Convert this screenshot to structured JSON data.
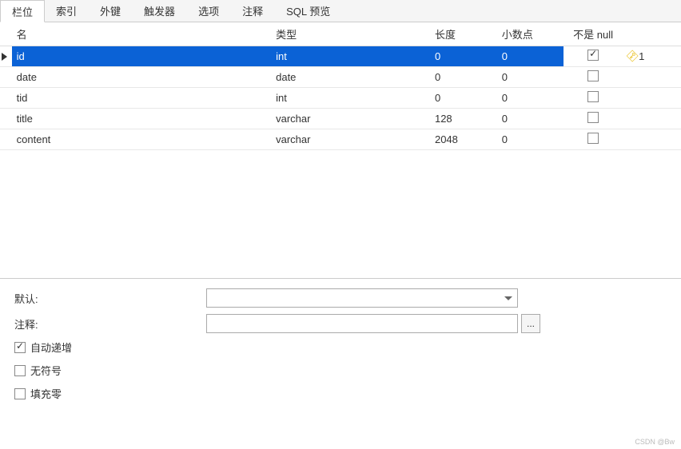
{
  "tabs": [
    {
      "label": "栏位",
      "active": true
    },
    {
      "label": "索引",
      "active": false
    },
    {
      "label": "外键",
      "active": false
    },
    {
      "label": "触发器",
      "active": false
    },
    {
      "label": "选项",
      "active": false
    },
    {
      "label": "注释",
      "active": false
    },
    {
      "label": "SQL 预览",
      "active": false
    }
  ],
  "columns": {
    "name": "名",
    "type": "类型",
    "length": "长度",
    "decimal": "小数点",
    "notnull": "不是 null"
  },
  "rows": [
    {
      "name": "id",
      "type": "int",
      "length": "0",
      "decimal": "0",
      "notnull": true,
      "pk": true,
      "selected": true
    },
    {
      "name": "date",
      "type": "date",
      "length": "0",
      "decimal": "0",
      "notnull": false,
      "pk": false,
      "selected": false
    },
    {
      "name": "tid",
      "type": "int",
      "length": "0",
      "decimal": "0",
      "notnull": false,
      "pk": false,
      "selected": false
    },
    {
      "name": "title",
      "type": "varchar",
      "length": "128",
      "decimal": "0",
      "notnull": false,
      "pk": false,
      "selected": false
    },
    {
      "name": "content",
      "type": "varchar",
      "length": "2048",
      "decimal": "0",
      "notnull": false,
      "pk": false,
      "selected": false
    }
  ],
  "pk_number": "1",
  "details": {
    "default_label": "默认:",
    "comment_label": "注释:",
    "dots": "...",
    "auto_increment": {
      "label": "自动递增",
      "checked": true
    },
    "unsigned": {
      "label": "无符号",
      "checked": false
    },
    "zerofill": {
      "label": "填充零",
      "checked": false
    }
  },
  "watermark": "CSDN @Bw"
}
